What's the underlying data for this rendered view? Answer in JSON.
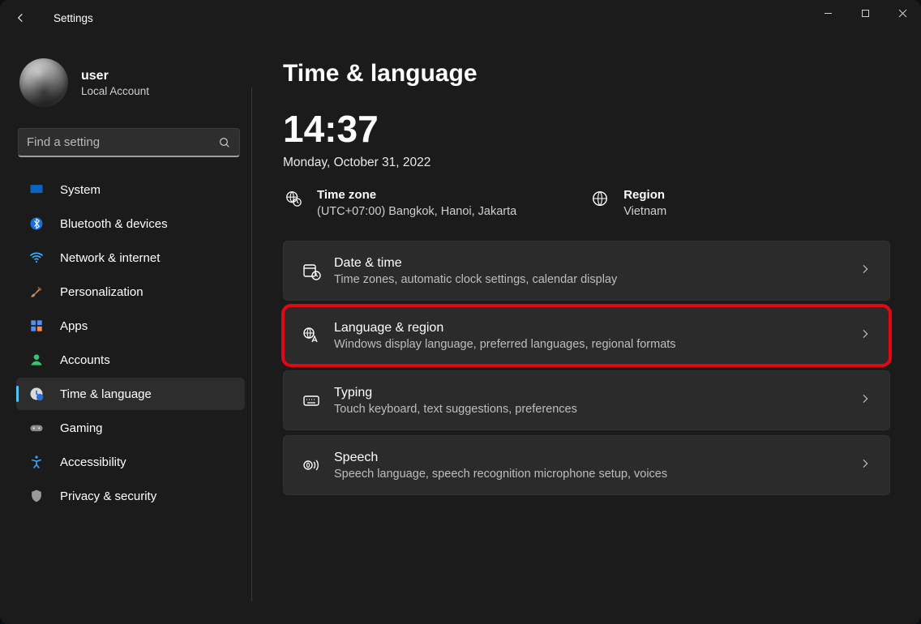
{
  "titlebar": {
    "title": "Settings"
  },
  "account": {
    "name": "user",
    "subtitle": "Local Account"
  },
  "search": {
    "placeholder": "Find a setting"
  },
  "nav": {
    "items": [
      {
        "label": "System"
      },
      {
        "label": "Bluetooth & devices"
      },
      {
        "label": "Network & internet"
      },
      {
        "label": "Personalization"
      },
      {
        "label": "Apps"
      },
      {
        "label": "Accounts"
      },
      {
        "label": "Time & language",
        "active": true
      },
      {
        "label": "Gaming"
      },
      {
        "label": "Accessibility"
      },
      {
        "label": "Privacy & security"
      }
    ]
  },
  "page": {
    "title": "Time & language",
    "clock": "14:37",
    "date": "Monday, October 31, 2022",
    "timezone": {
      "title": "Time zone",
      "value": "(UTC+07:00) Bangkok, Hanoi, Jakarta"
    },
    "region": {
      "title": "Region",
      "value": "Vietnam"
    },
    "cards": [
      {
        "title": "Date & time",
        "sub": "Time zones, automatic clock settings, calendar display"
      },
      {
        "title": "Language & region",
        "sub": "Windows display language, preferred languages, regional formats",
        "highlight": true
      },
      {
        "title": "Typing",
        "sub": "Touch keyboard, text suggestions, preferences"
      },
      {
        "title": "Speech",
        "sub": "Speech language, speech recognition microphone setup, voices"
      }
    ]
  }
}
